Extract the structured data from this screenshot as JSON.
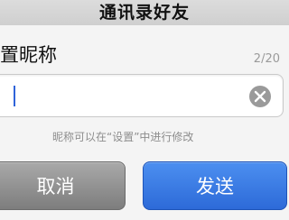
{
  "header": {
    "title": "通讯录好友"
  },
  "dialog": {
    "title": "置昵称",
    "counter": "2/20",
    "input": {
      "value": "",
      "placeholder": ""
    },
    "hint": "昵称可以在“设置”中进行修改",
    "cancel_label": "取消",
    "send_label": "发送"
  },
  "colors": {
    "send_button": "#2f6fdd",
    "cancel_button": "#8c8c8c",
    "caret": "#2f63d9"
  },
  "icons": {
    "clear": "clear-icon"
  }
}
